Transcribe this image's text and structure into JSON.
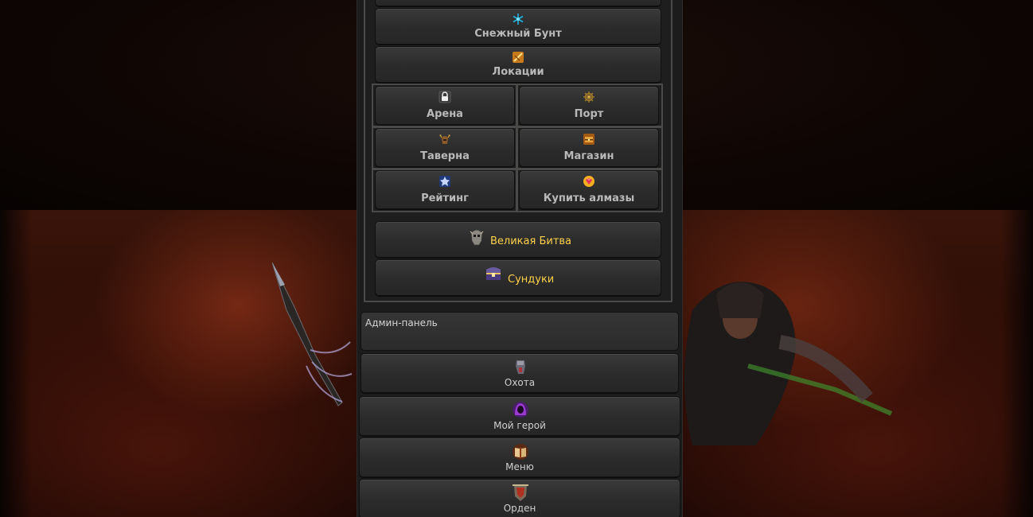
{
  "menu": {
    "snow_riot": {
      "label": "Снежный Бунт",
      "icon": "snowflake-icon"
    },
    "locations": {
      "label": "Локации",
      "icon": "map-scroll-icon"
    }
  },
  "grid": {
    "arena": {
      "label": "Арена",
      "icon": "lock-icon"
    },
    "port": {
      "label": "Порт",
      "icon": "ship-wheel-icon"
    },
    "tavern": {
      "label": "Таверна",
      "icon": "helmet-icon"
    },
    "shop": {
      "label": "Магазин",
      "icon": "shop-chest-icon"
    },
    "rating": {
      "label": "Рейтинг",
      "icon": "emblem-icon"
    },
    "buy_diamonds": {
      "label": "Купить алмазы",
      "icon": "diamond-icon"
    }
  },
  "events": {
    "great_battle": {
      "label": "Великая Битва",
      "icon": "skull-helmet-icon"
    },
    "chests": {
      "label": "Сундуки",
      "icon": "treasure-chest-icon"
    }
  },
  "admin": {
    "label": "Админ-панель"
  },
  "nav": {
    "hunt": {
      "label": "Охота",
      "icon": "fist-icon"
    },
    "my_hero": {
      "label": "Мой герой",
      "icon": "hooded-hero-icon"
    },
    "menu": {
      "label": "Меню",
      "icon": "book-icon"
    },
    "order": {
      "label": "Орден",
      "icon": "banner-icon"
    }
  },
  "colors": {
    "gold_text": "#ffd24a",
    "button_text": "#b9b9b9",
    "frame": "#4a4a48"
  }
}
